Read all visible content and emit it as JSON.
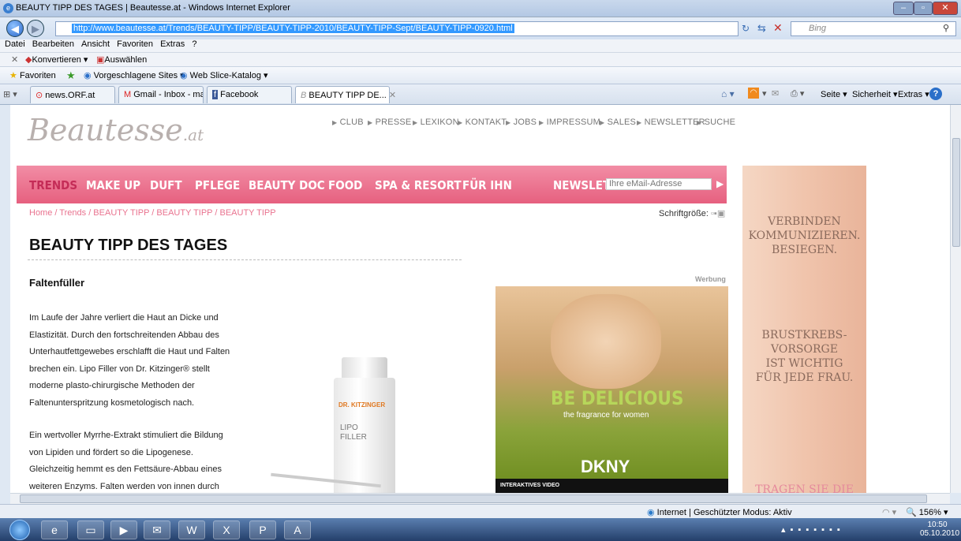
{
  "window": {
    "title": "BEAUTY TIPP DES TAGES | Beautesse.at - Windows Internet Explorer"
  },
  "address": {
    "url": "http://www.beautesse.at/Trends/BEAUTY-TIPP/BEAUTY-TIPP-2010/BEAUTY-TIPP-Sept/BEAUTY-TIPP-0920.html",
    "search_placeholder": "Bing"
  },
  "menu": [
    "Datei",
    "Bearbeiten",
    "Ansicht",
    "Favoriten",
    "Extras",
    "?"
  ],
  "convert": {
    "konvertieren": "Konvertieren",
    "auswaehlen": "Auswählen"
  },
  "favorites": {
    "label": "Favoriten",
    "suggested": "Vorgeschlagene Sites",
    "webslice": "Web Slice-Katalog"
  },
  "tabs": [
    "news.ORF.at",
    "Gmail - Inbox - man...",
    "Facebook",
    "BEAUTY TIPP DE..."
  ],
  "cmdbar": {
    "seite": "Seite",
    "sicherheit": "Sicherheit",
    "extras": "Extras"
  },
  "site": {
    "logo": "Beautesse",
    "logo_suffix": ".at",
    "topnav": [
      "CLUB",
      "PRESSE",
      "LEXIKON",
      "KONTAKT",
      "JOBS",
      "IMPRESSUM",
      "SALES",
      "NEWSLETTER",
      "SUCHE"
    ],
    "mainnav": [
      "TRENDS",
      "MAKE UP",
      "DUFT",
      "PFLEGE",
      "BEAUTY DOC",
      "FOOD",
      "SPA & RESORT",
      "FÜR IHN"
    ],
    "newsletter_label": "NEWSLETTER",
    "newsletter_placeholder": "Ihre eMail-Adresse",
    "breadcrumb": "Home / Trends / BEAUTY TIPP / BEAUTY TIPP / BEAUTY TIPP",
    "fontsize_label": "Schriftgröße:",
    "heading": "BEAUTY TIPP DES TAGES",
    "subheading": "Faltenfüller",
    "para1": [
      "Im Laufe der Jahre verliert die Haut an Dicke und",
      "Elastizität. Durch den fortschreitenden Abbau des",
      "Unterhautfettgewebes erschlafft die Haut und Falten",
      "brechen ein. Lipo Filler von Dr. Kitzinger® stellt",
      "moderne plasto-chirurgische Methoden der",
      "Faltenunterspritzung kosmetologisch nach."
    ],
    "para2": [
      "Ein wertvoller Myrrhe-Extrakt stimuliert die Bildung",
      "von Lipiden und fördert so die Lipogenese.",
      "Gleichzeitig hemmt es den Fettsäure-Abbau eines",
      "weiteren Enzyms. Falten werden von innen durch"
    ],
    "product": {
      "brand": "DR. KITZINGER",
      "name1": "LIPO",
      "name2": "FILLER"
    },
    "ad_label": "Werbung",
    "ad": {
      "headline": "BE DELICIOUS",
      "tagline": "the fragrance for women",
      "brand": "DKNY",
      "footer": "INTERAKTIVES VIDEO"
    },
    "banner": {
      "line1": [
        "VERBINDEN",
        "KOMMUNIZIEREN.",
        "BESIEGEN."
      ],
      "line2": [
        "BRUSTKREBS-",
        "VORSORGE",
        "IST WICHTIG",
        "FÜR JEDE FRAU."
      ],
      "line3": "TRAGEN SIE DIE"
    }
  },
  "status": {
    "zone": "Internet | Geschützter Modus: Aktiv",
    "zoom": "156%"
  },
  "clock": {
    "time": "10:50",
    "date": "05.10.2010"
  }
}
